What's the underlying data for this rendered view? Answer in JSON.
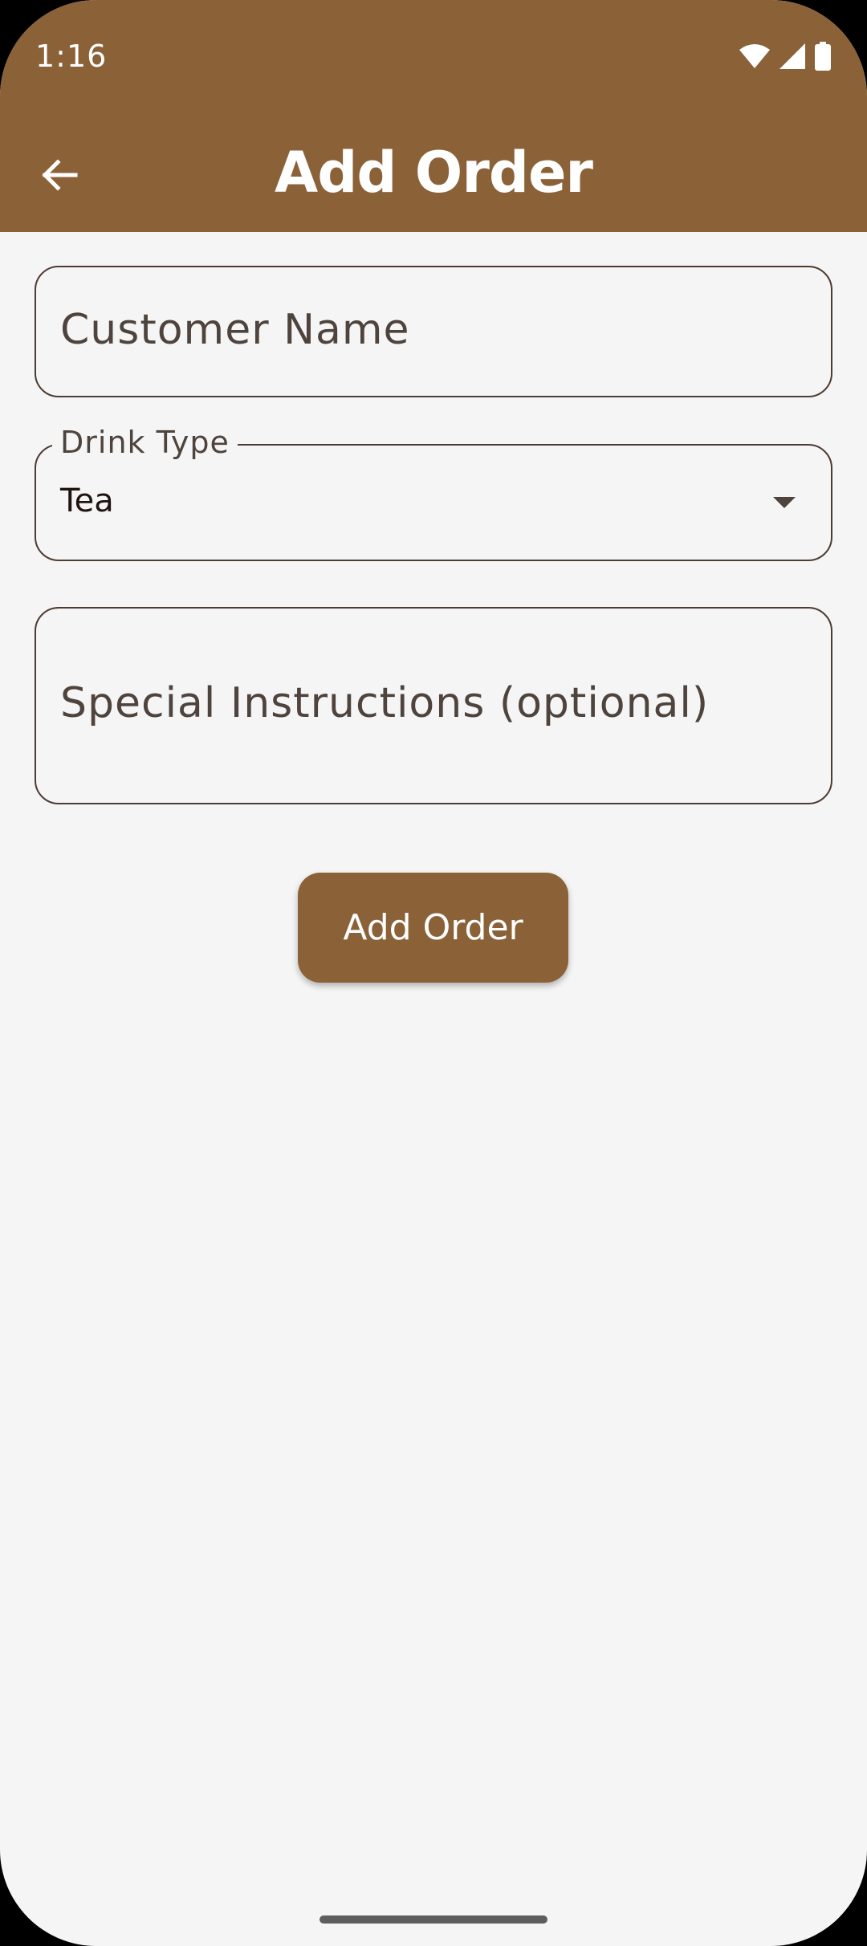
{
  "status_bar": {
    "time": "1:16",
    "icons": [
      "wifi-icon",
      "signal-icon",
      "battery-icon"
    ]
  },
  "app_bar": {
    "title": "Add Order",
    "back_icon": "arrow-back-icon"
  },
  "form": {
    "customer_name": {
      "placeholder": "Customer Name",
      "value": ""
    },
    "drink_type": {
      "label": "Drink Type",
      "selected": "Tea"
    },
    "special_instructions": {
      "placeholder": "Special Instructions (optional)",
      "value": ""
    },
    "submit_label": "Add Order"
  },
  "colors": {
    "primary": "#8B6138",
    "background": "#F5F5F5",
    "outline": "#4E3B31",
    "on_primary": "#FFFFFF"
  }
}
